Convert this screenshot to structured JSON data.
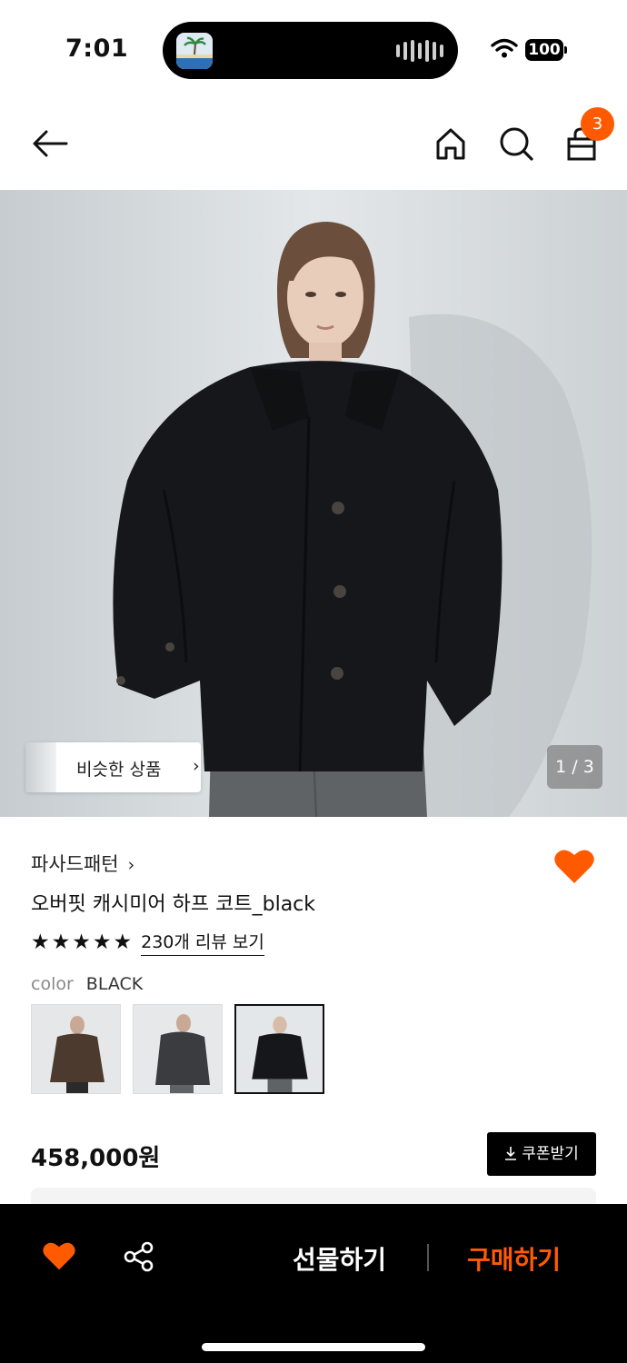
{
  "status_bar": {
    "time": "7:01",
    "battery": "100"
  },
  "nav": {
    "cart_count": "3"
  },
  "hero": {
    "similar_label": "비슷한 상품",
    "page_indicator": "1 / 3"
  },
  "product": {
    "brand": "파사드패턴",
    "name": "오버핏 캐시미어 하프 코트_black",
    "rating_stars": 5,
    "review_link": "230개 리뷰 보기",
    "color_label": "color",
    "color_value": "BLACK",
    "swatches": [
      {
        "name": "brown",
        "selected": false
      },
      {
        "name": "charcoal",
        "selected": false
      },
      {
        "name": "black",
        "selected": true
      }
    ],
    "price": "458,000원",
    "coupon_label": "쿠폰받기"
  },
  "bottom_bar": {
    "gift_label": "선물하기",
    "buy_label": "구매하기"
  },
  "colors": {
    "accent": "#ff5a00",
    "bar": "#000000"
  },
  "icons": [
    "back-arrow-icon",
    "home-icon",
    "search-icon",
    "shopping-bag-icon",
    "heart-icon",
    "share-icon",
    "download-icon",
    "wifi-icon"
  ]
}
